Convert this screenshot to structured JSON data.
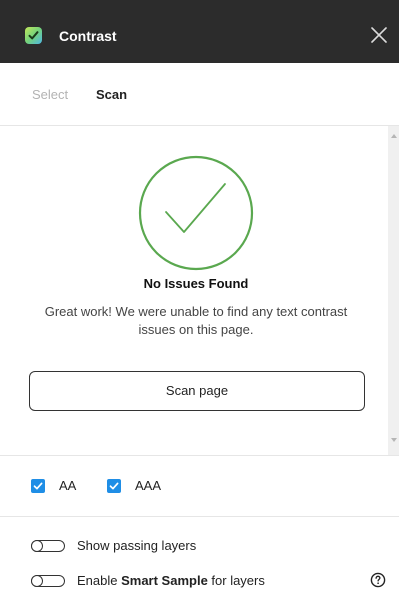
{
  "window": {
    "title": "Contrast",
    "app_icon": "contrast-plugin-icon",
    "close_icon": "close-icon"
  },
  "tabs": [
    {
      "label": "Select",
      "active": false
    },
    {
      "label": "Scan",
      "active": true
    }
  ],
  "result": {
    "icon": "check-circle-icon",
    "heading": "No Issues Found",
    "description": "Great work! We were unable to find any text contrast issues on this page.",
    "button_label": "Scan page"
  },
  "standards": [
    {
      "label": "AA",
      "checked": true
    },
    {
      "label": "AAA",
      "checked": true
    }
  ],
  "options": {
    "show_passing": {
      "label": "Show passing layers",
      "enabled": false
    },
    "smart_sample": {
      "prefix": "Enable ",
      "bold": "Smart Sample",
      "suffix": " for layers",
      "enabled": false
    }
  },
  "help_icon": "help-icon",
  "colors": {
    "titlebar": "#2c2c2c",
    "success_green": "#5aa84f",
    "checkbox_blue": "#1f8ee6"
  }
}
